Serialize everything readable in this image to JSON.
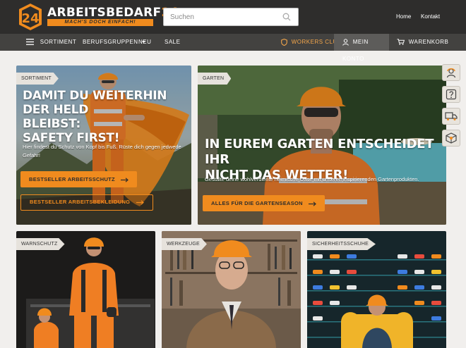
{
  "brand": {
    "name_main": "ARBEITSBEDARF",
    "name_num": "24",
    "tagline": "MACH'S DOCH EINFACH!",
    "colors": {
      "accent": "#f08b1e",
      "header": "#2e2d2c",
      "nav": "#434240"
    }
  },
  "search": {
    "placeholder": "Suchen",
    "value": ""
  },
  "top_links": {
    "home": "Home",
    "contact": "Kontakt"
  },
  "nav": {
    "menu_label": "SORTIMENT",
    "items": [
      "BERUFSGRUPPEN",
      "NEU",
      "SALE"
    ],
    "workers_club": "WORKERS CLUB",
    "account": "MEIN KONTO",
    "cart": "WARENKORB"
  },
  "hero_left": {
    "tag": "SORTIMENT",
    "headline": [
      "DAMIT DU WEITERHIN DER HELD",
      "BLEIBST:",
      "SAFETY FIRST!"
    ],
    "text": [
      "Hier findest du Schutz von Kopf bis Fuß. Rüste dich gegen jedwede",
      "Gefahr!"
    ],
    "button1": "BESTSELLER ARBEITSSCHUTZ",
    "button2": "BESTSELLER ARBEITSBEKLEIDUNG"
  },
  "hero_right": {
    "tag": "GARTEN",
    "headline": [
      "IN EUREM GARTEN ENTSCHEIDET IHR",
      "NICHT DAS WETTER!"
    ],
    "text": "Gestalte deine wohlverdiente heimische Oase mit unseren inspirierenden Gartenprodukten.",
    "button": "ALLES FÜR DIE GARTENSEASON"
  },
  "tiles": [
    {
      "tag": "WARNSCHUTZ"
    },
    {
      "tag": "WERKZEUGE"
    },
    {
      "tag": "SICHERHEITSSCHUHE"
    }
  ],
  "side_rail": [
    "support-agent-icon",
    "question-icon",
    "delivery-truck-icon",
    "package-icon"
  ]
}
